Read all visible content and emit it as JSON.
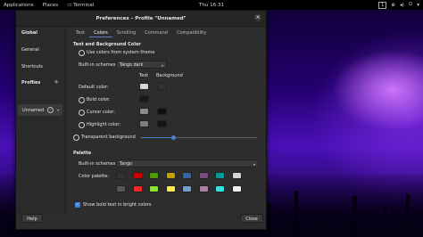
{
  "topbar": {
    "applications": "Applications",
    "places": "Places",
    "app_name": "Terminal",
    "clock": "Thu 16:31",
    "workspace": "1"
  },
  "dialog": {
    "title": "Preferences – Profile \"Unnamed\""
  },
  "sidebar": {
    "global": "Global",
    "general": "General",
    "shortcuts": "Shortcuts",
    "profiles": "Profiles",
    "profile_name": "Unnamed"
  },
  "tabs": [
    "Text",
    "Colors",
    "Scrolling",
    "Command",
    "Compatibility"
  ],
  "colors": {
    "section_text_bg": "Text and Background Color",
    "use_system_theme": "Use colors from system theme",
    "builtin_schemes_label": "Built-in schemes:",
    "builtin_schemes_value": "Tango dark",
    "col_text": "Text",
    "col_background": "Background",
    "default_color": "Default color:",
    "bold_color": "Bold color:",
    "cursor_color": "Cursor color:",
    "highlight_color": "Highlight color:",
    "transparent_bg": "Transparent background",
    "transparency_level": 0.28,
    "section_palette": "Palette",
    "palette_schemes_label": "Built-in schemes:",
    "palette_schemes_value": "Tango",
    "color_palette_label": "Color palette:",
    "show_bold_bright": "Show bold text in bright colors"
  },
  "swatch_colors": {
    "default_text": "#d3d7cf",
    "default_bg": "#2e3436",
    "bold_bg": "#1a1a1a",
    "cursor_text": "#8a8a8a",
    "cursor_bg": "#111111",
    "highlight_text": "#7d7d7d",
    "highlight_bg": "#151515"
  },
  "palette_row1": [
    "#2e3436",
    "#cc0000",
    "#4e9a06",
    "#c4a000",
    "#3465a4",
    "#75507b",
    "#06989a",
    "#d3d7cf"
  ],
  "palette_row2": [
    "#555753",
    "#ef2929",
    "#8ae234",
    "#fce94f",
    "#729fcf",
    "#ad7fa8",
    "#34e2e2",
    "#eeeeec"
  ],
  "footer": {
    "help": "Help",
    "close": "Close"
  }
}
